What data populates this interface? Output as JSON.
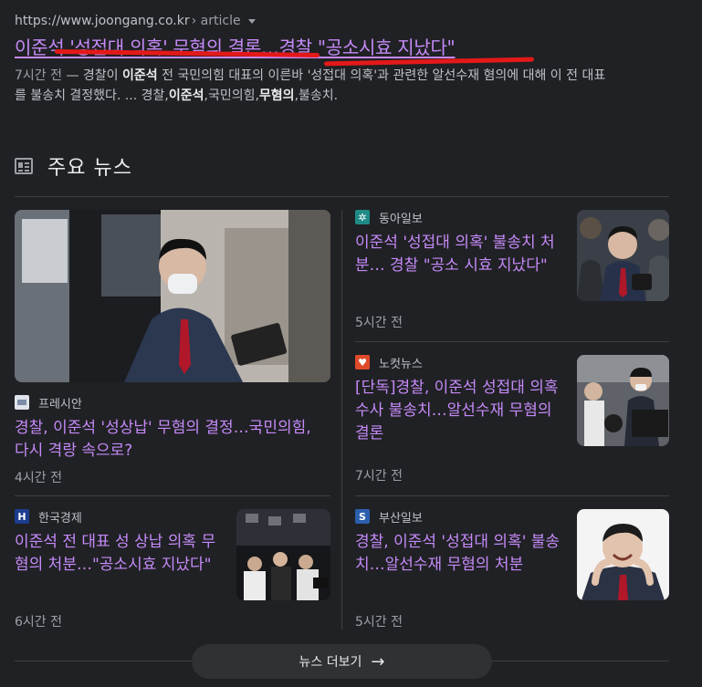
{
  "result": {
    "url": "https://www.joongang.co.kr",
    "crumb": "› article",
    "title": "이준석 '성접대 의혹' 무혐의 결론…경찰 \"공소시효 지났다\"",
    "snippet_age": "7시간 전",
    "snippet_parts": [
      " — 경찰이 ",
      "이준석",
      " 전 국민의힘 대표의 이른바 '성접대 의혹'과 관련한 알선수재 혐의에 대해 이 전 대표를 불송치 결정했다. ... 경찰,",
      "이준석",
      ",국민의힘,",
      "무혐의",
      ",불송치."
    ]
  },
  "top_news": {
    "title": "주요 뉴스",
    "icon": "news-icon",
    "more_label": "뉴스 더보기",
    "more_arrow": "→"
  },
  "articles": [
    {
      "source": "프레시안",
      "favicon_text": "",
      "favicon_color": "#dfe3ea",
      "headline": "경찰, 이준석 '성상납' 무혐의 결정…국민의힘, 다시 격랑 속으로?",
      "time": "4시간 전"
    },
    {
      "source": "동아일보",
      "favicon_text": "✲",
      "favicon_color": "#1f8a86",
      "headline": "이준석 '성접대 의혹' 불송치 처분… 경찰 \"공소 시효 지났다\"",
      "time": "5시간 전"
    },
    {
      "source": "노컷뉴스",
      "favicon_text": "♥",
      "favicon_color": "#e04a2b",
      "headline": "[단독]경찰, 이준석 성접대 의혹 수사 불송치…알선수재 무혐의 결론",
      "time": "7시간 전"
    },
    {
      "source": "한국경제",
      "favicon_text": "H",
      "favicon_color": "#1c3d8f",
      "headline": "이준석 전 대표 성 상납 의혹 무혐의 처분…\"공소시효 지났다\"",
      "time": "6시간 전"
    },
    {
      "source": "부산일보",
      "favicon_text": "S",
      "favicon_color": "#2b5fae",
      "headline": "경찰, 이준석 '성접대 의혹' 불송치…알선수재 무혐의 처분",
      "time": "5시간 전"
    }
  ]
}
